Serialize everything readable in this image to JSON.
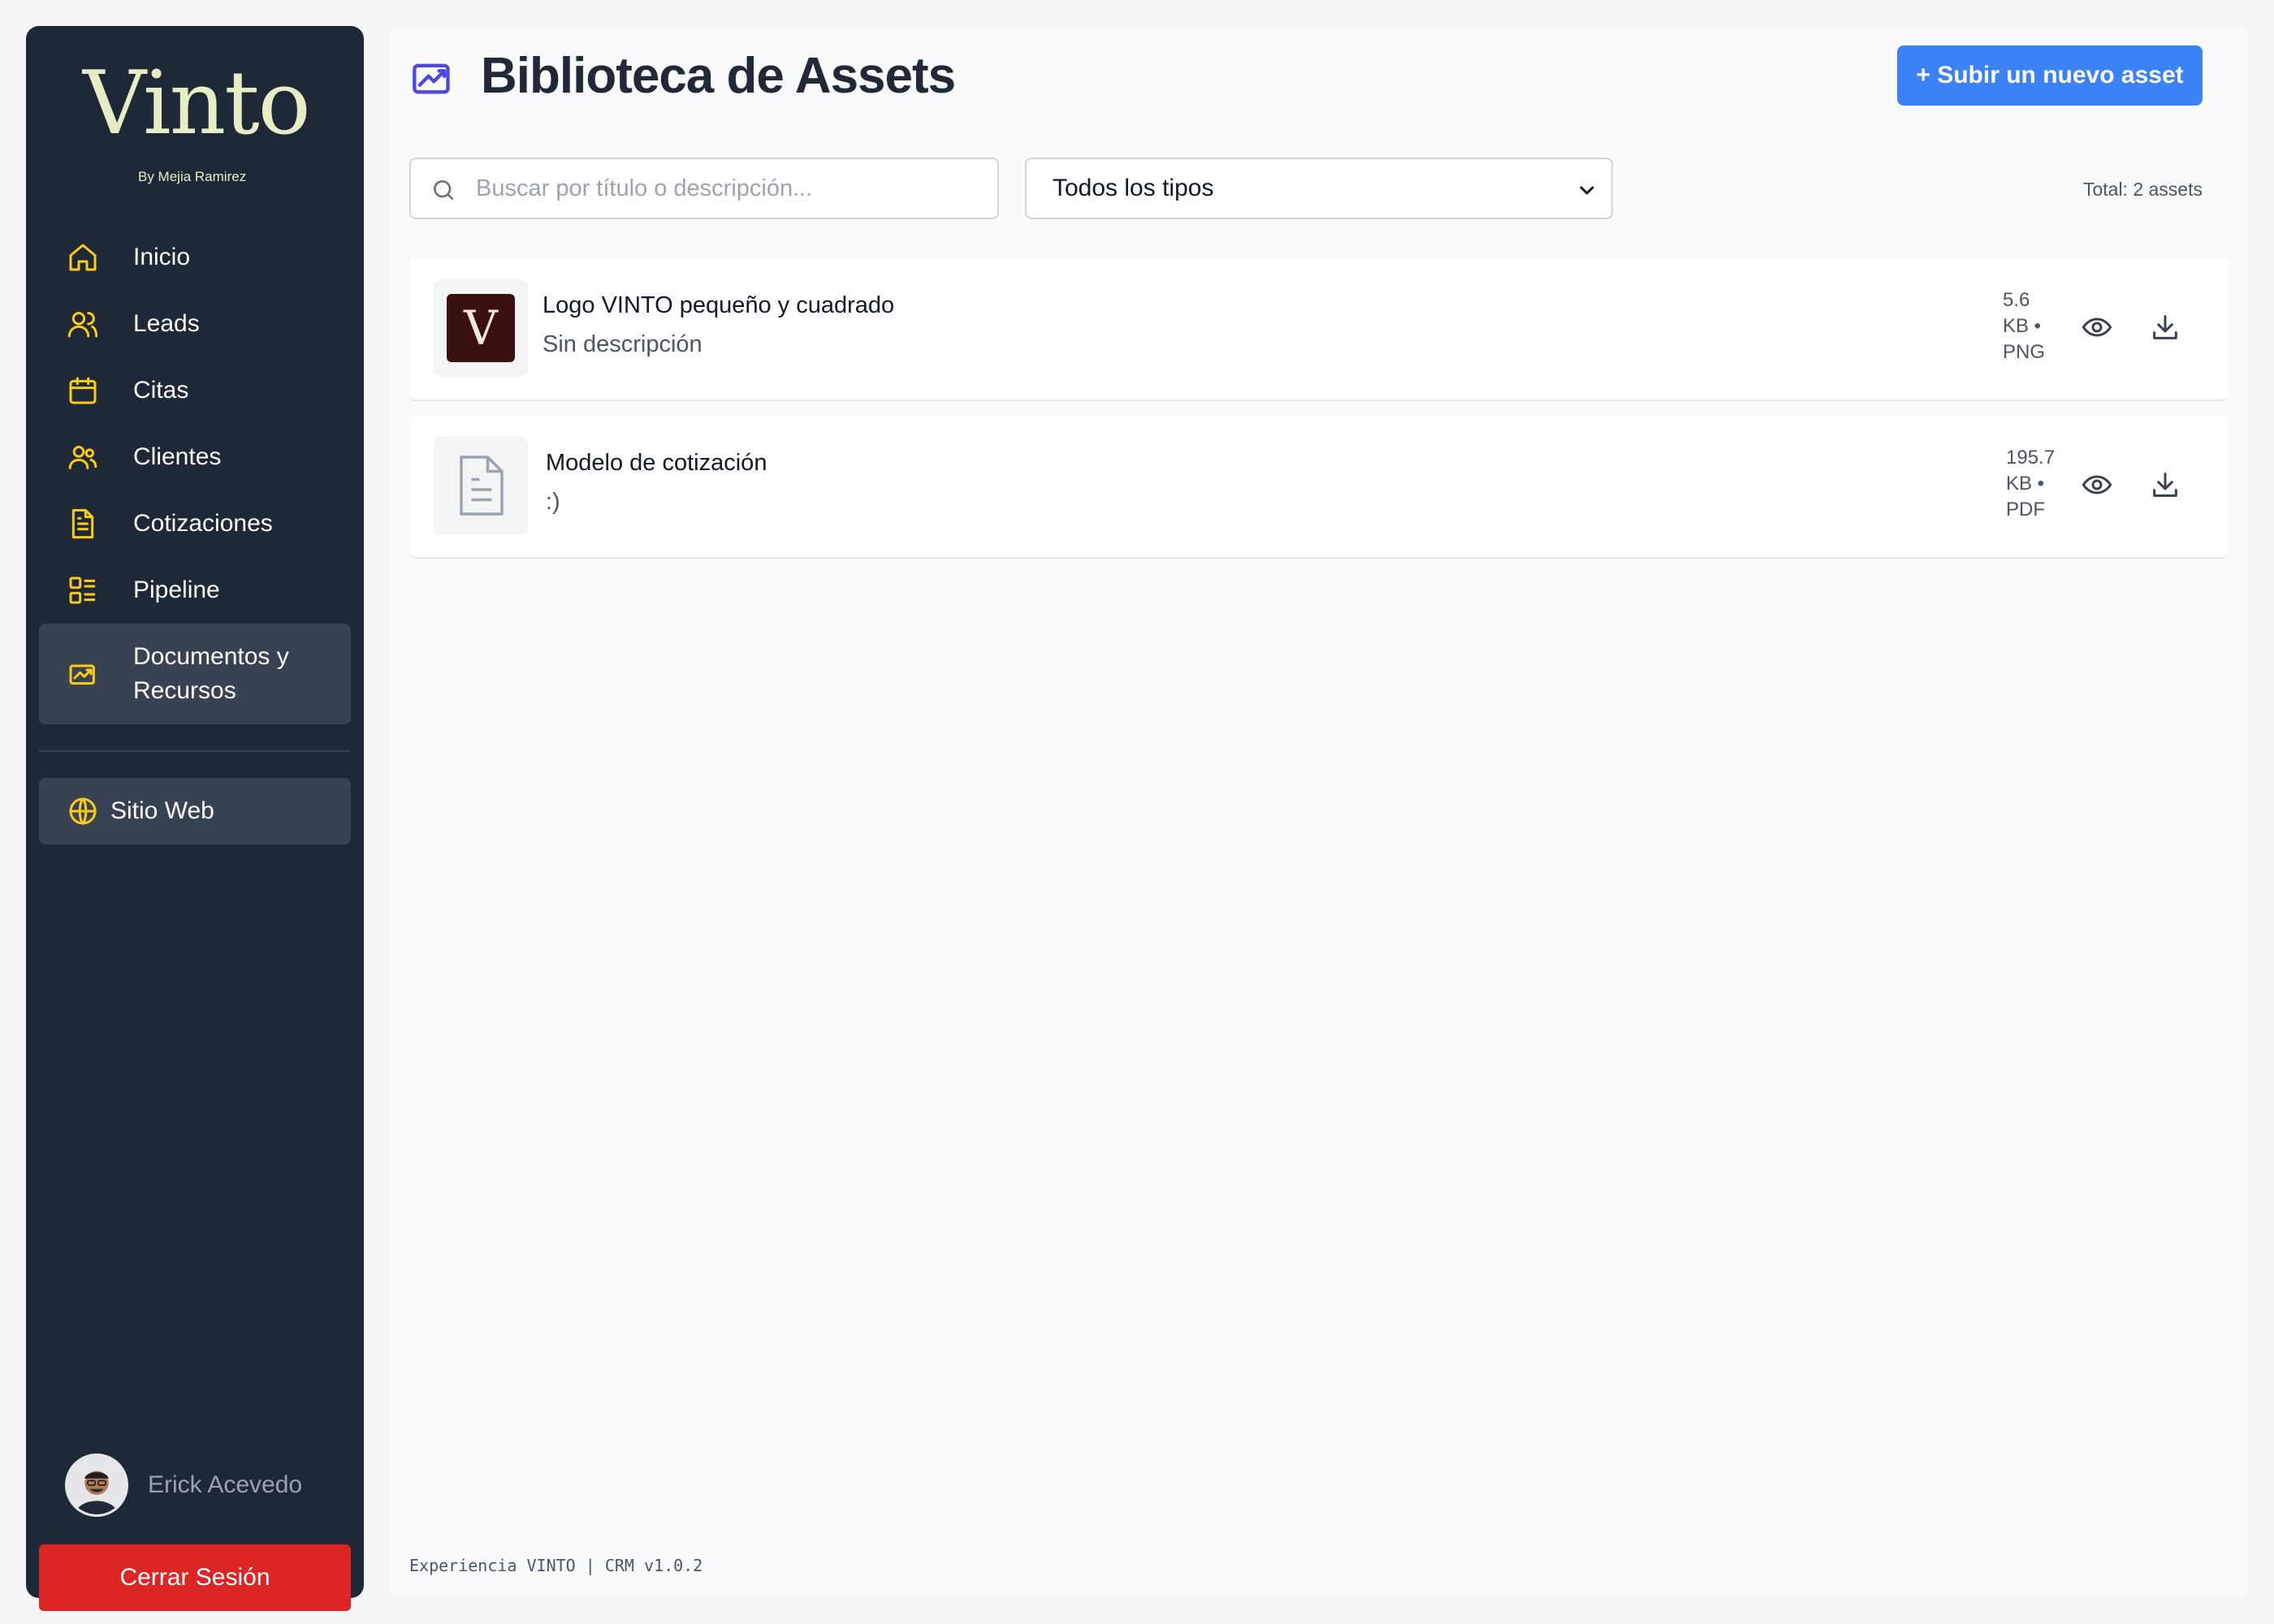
{
  "brand": {
    "logo_text": "Vinto",
    "logo_subtitle": "By Mejia Ramirez"
  },
  "sidebar": {
    "items": [
      {
        "label": "Inicio",
        "icon": "home-icon"
      },
      {
        "label": "Leads",
        "icon": "users-icon"
      },
      {
        "label": "Citas",
        "icon": "calendar-icon"
      },
      {
        "label": "Clientes",
        "icon": "users-group-icon"
      },
      {
        "label": "Cotizaciones",
        "icon": "document-icon"
      },
      {
        "label": "Pipeline",
        "icon": "pipeline-icon"
      },
      {
        "label": "Documentos y Recursos",
        "icon": "chart-folder-icon",
        "active": true
      }
    ],
    "website": {
      "label": "Sitio Web",
      "icon": "globe-icon"
    },
    "user": {
      "name": "Erick Acevedo"
    },
    "logout_label": "Cerrar Sesión"
  },
  "header": {
    "title": "Biblioteca de Assets",
    "upload_label": "+ Subir un nuevo asset"
  },
  "filters": {
    "search_placeholder": "Buscar por título o descripción...",
    "type_selected": "Todos los tipos",
    "total_label": "Total: 2 assets"
  },
  "assets": [
    {
      "title": "Logo VINTO pequeño y cuadrado",
      "description": "Sin descripción",
      "size": "5.6",
      "unit": "KB •",
      "type": "PNG",
      "thumb_text": "V"
    },
    {
      "title": "Modelo de cotización",
      "description": ":)",
      "size": "195.7",
      "unit": "KB •",
      "type": "PDF"
    }
  ],
  "footer": {
    "text": "Experiencia VINTO | CRM v1.0.2"
  },
  "colors": {
    "sidebar_bg": "#1e2837",
    "icon_accent": "#facc15",
    "primary": "#3b82f6",
    "danger": "#dc2626",
    "title_icon": "#4f46e5"
  }
}
